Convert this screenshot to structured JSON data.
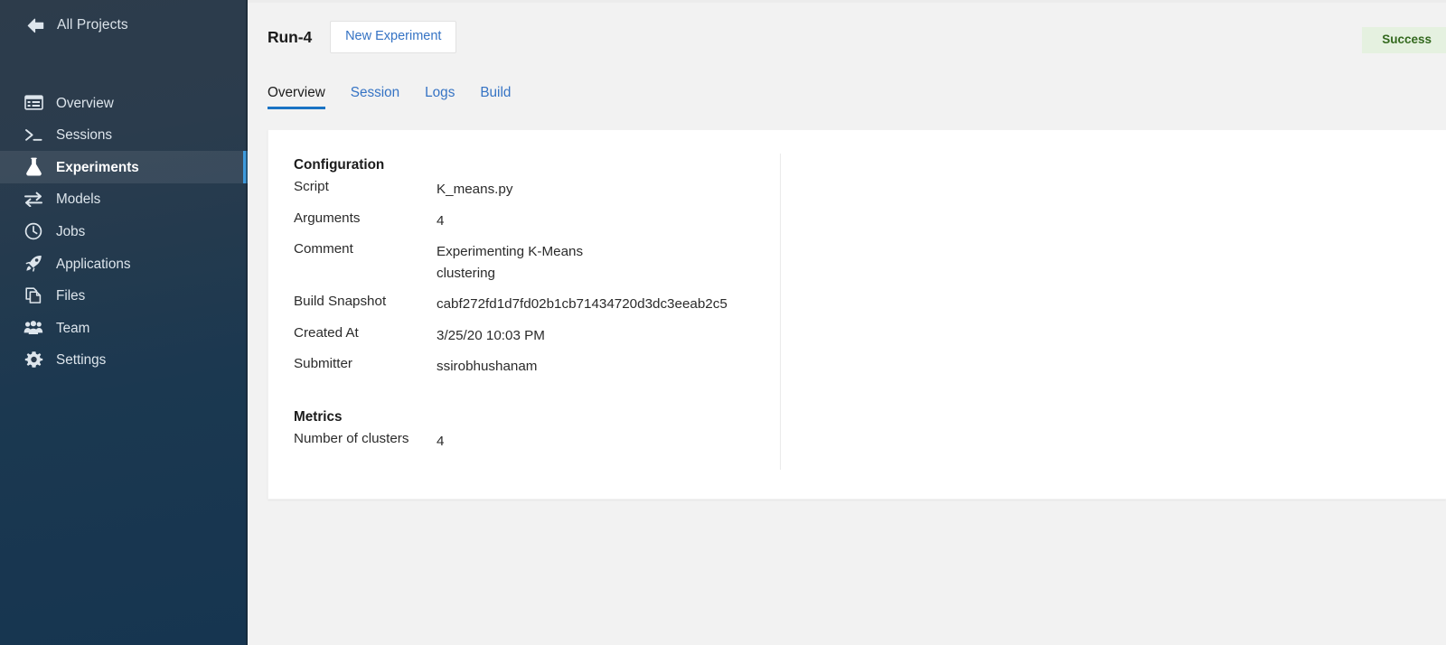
{
  "sidebar": {
    "back": {
      "label": "All Projects",
      "icon": "arrow-left-icon"
    },
    "items": [
      {
        "label": "Overview",
        "icon": "list-icon",
        "active": false
      },
      {
        "label": "Sessions",
        "icon": "terminal-icon",
        "active": false
      },
      {
        "label": "Experiments",
        "icon": "flask-icon",
        "active": true
      },
      {
        "label": "Models",
        "icon": "exchange-icon",
        "active": false
      },
      {
        "label": "Jobs",
        "icon": "clock-icon",
        "active": false
      },
      {
        "label": "Applications",
        "icon": "rocket-icon",
        "active": false
      },
      {
        "label": "Files",
        "icon": "files-icon",
        "active": false
      },
      {
        "label": "Team",
        "icon": "people-icon",
        "active": false
      },
      {
        "label": "Settings",
        "icon": "gear-icon",
        "active": false
      }
    ]
  },
  "header": {
    "run_title": "Run-4",
    "new_experiment_label": "New Experiment",
    "status": "Success"
  },
  "tabs": [
    {
      "label": "Overview",
      "active": true
    },
    {
      "label": "Session",
      "active": false
    },
    {
      "label": "Logs",
      "active": false
    },
    {
      "label": "Build",
      "active": false
    }
  ],
  "configuration": {
    "heading": "Configuration",
    "rows": [
      {
        "key": "Script",
        "value": "K_means.py"
      },
      {
        "key": "Arguments",
        "value": "4"
      },
      {
        "key": "Comment",
        "value": "Experimenting K-Means\nclustering"
      },
      {
        "key": "Build Snapshot",
        "value": "cabf272fd1d7fd02b1cb71434720d3dc3eeab2c5"
      },
      {
        "key": "Created At",
        "value": "3/25/20 10:03 PM"
      },
      {
        "key": "Submitter",
        "value": "ssirobhushanam"
      }
    ]
  },
  "metrics": {
    "heading": "Metrics",
    "rows": [
      {
        "key": "Number of clusters",
        "value": "4"
      }
    ]
  },
  "colors": {
    "accent_blue": "#3573c4",
    "active_bar": "#3e9bdd",
    "success_bg": "#e5f1e0",
    "success_fg": "#33691e",
    "sidebar_top": "#2d3c4b",
    "sidebar_bottom": "#163550"
  }
}
